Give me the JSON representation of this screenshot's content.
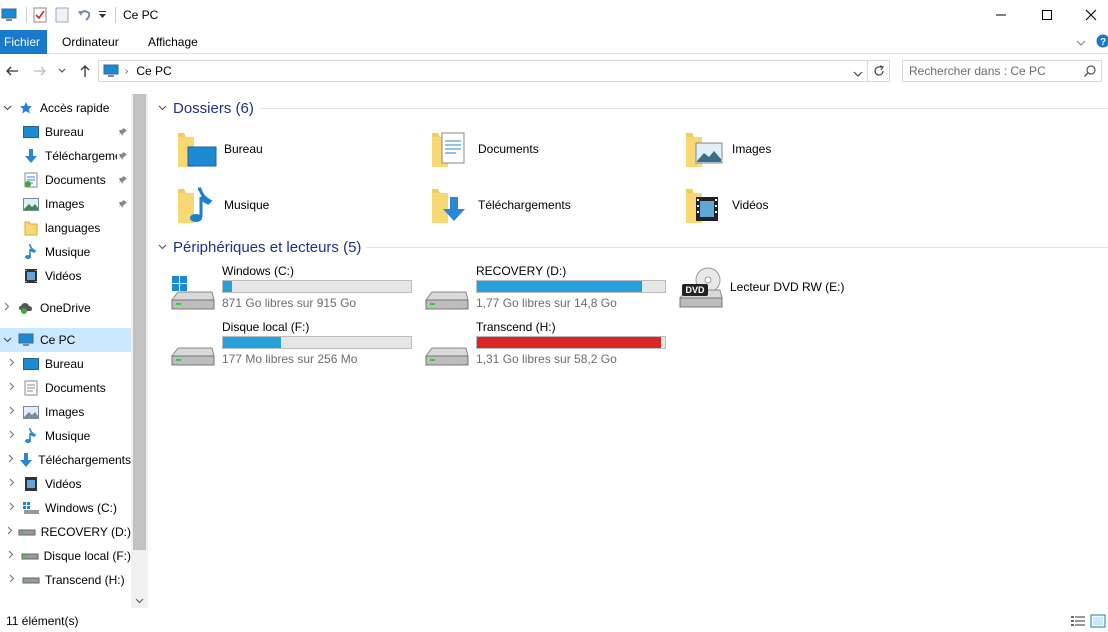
{
  "window": {
    "title": "Ce PC",
    "minimize_icon": "minimize-icon",
    "maximize_icon": "maximize-icon",
    "close_icon": "close-icon"
  },
  "ribbon": {
    "tabs": [
      {
        "label": "Fichier",
        "active": true
      },
      {
        "label": "Ordinateur",
        "active": false
      },
      {
        "label": "Affichage",
        "active": false
      }
    ],
    "accent": "#1979ca"
  },
  "address": {
    "path": "Ce PC",
    "search_placeholder": "Rechercher dans : Ce PC"
  },
  "nav": {
    "items": [
      {
        "label": "Accès rapide",
        "icon": "star-icon",
        "pinned": false
      },
      {
        "label": "Bureau",
        "icon": "desktop-icon",
        "pinned": true
      },
      {
        "label": "Téléchargements",
        "icon": "download-icon",
        "pinned": true
      },
      {
        "label": "Documents",
        "icon": "documents-icon",
        "pinned": true
      },
      {
        "label": "Images",
        "icon": "images-icon",
        "pinned": true
      },
      {
        "label": "languages",
        "icon": "folder-icon",
        "pinned": false
      },
      {
        "label": "Musique",
        "icon": "music-icon",
        "pinned": false
      },
      {
        "label": "Vidéos",
        "icon": "videos-icon",
        "pinned": false
      },
      {
        "label": "OneDrive",
        "icon": "onedrive-icon",
        "pinned": false
      },
      {
        "label": "Ce PC",
        "icon": "computer-icon",
        "pinned": false
      },
      {
        "label": "Bureau",
        "icon": "desktop-icon",
        "pinned": false
      },
      {
        "label": "Documents",
        "icon": "documents-icon",
        "pinned": false
      },
      {
        "label": "Images",
        "icon": "images-icon",
        "pinned": false
      },
      {
        "label": "Musique",
        "icon": "music-icon",
        "pinned": false
      },
      {
        "label": "Téléchargements",
        "icon": "download-icon",
        "pinned": false
      },
      {
        "label": "Vidéos",
        "icon": "videos-icon",
        "pinned": false
      },
      {
        "label": "Windows (C:)",
        "icon": "windows-drive-icon",
        "pinned": false
      },
      {
        "label": "RECOVERY (D:)",
        "icon": "drive-icon",
        "pinned": false
      },
      {
        "label": "Disque local (F:)",
        "icon": "drive-icon",
        "pinned": false
      },
      {
        "label": "Transcend (H:)",
        "icon": "drive-icon",
        "pinned": false
      }
    ]
  },
  "content": {
    "folders_header": "Dossiers (6)",
    "folders": [
      {
        "label": "Bureau",
        "icon": "desktop-folder-icon"
      },
      {
        "label": "Documents",
        "icon": "documents-folder-icon"
      },
      {
        "label": "Images",
        "icon": "images-folder-icon"
      },
      {
        "label": "Musique",
        "icon": "music-folder-icon"
      },
      {
        "label": "Téléchargements",
        "icon": "downloads-folder-icon"
      },
      {
        "label": "Vidéos",
        "icon": "videos-folder-icon"
      }
    ],
    "devices_header": "Périphériques et lecteurs (5)",
    "drives": [
      {
        "name": "Windows (C:)",
        "free": "871 Go libres sur 915 Go",
        "used_fraction": 0.048,
        "bar_color": "#26a0da",
        "icon": "windows-drive-icon"
      },
      {
        "name": "RECOVERY (D:)",
        "free": "1,77 Go libres sur 14,8 Go",
        "used_fraction": 0.88,
        "bar_color": "#26a0da",
        "icon": "drive-icon"
      },
      {
        "name": "Disque local (F:)",
        "free": "177 Mo libres sur 256 Mo",
        "used_fraction": 0.31,
        "bar_color": "#26a0da",
        "icon": "drive-icon"
      },
      {
        "name": "Transcend (H:)",
        "free": "1,31 Go libres sur 58,2 Go",
        "used_fraction": 0.978,
        "bar_color": "#da2626",
        "icon": "drive-icon"
      }
    ],
    "dvd": {
      "name": "Lecteur DVD RW (E:)",
      "icon": "dvd-drive-icon",
      "badge": "DVD"
    }
  },
  "status": {
    "count": "11 élément(s)"
  }
}
